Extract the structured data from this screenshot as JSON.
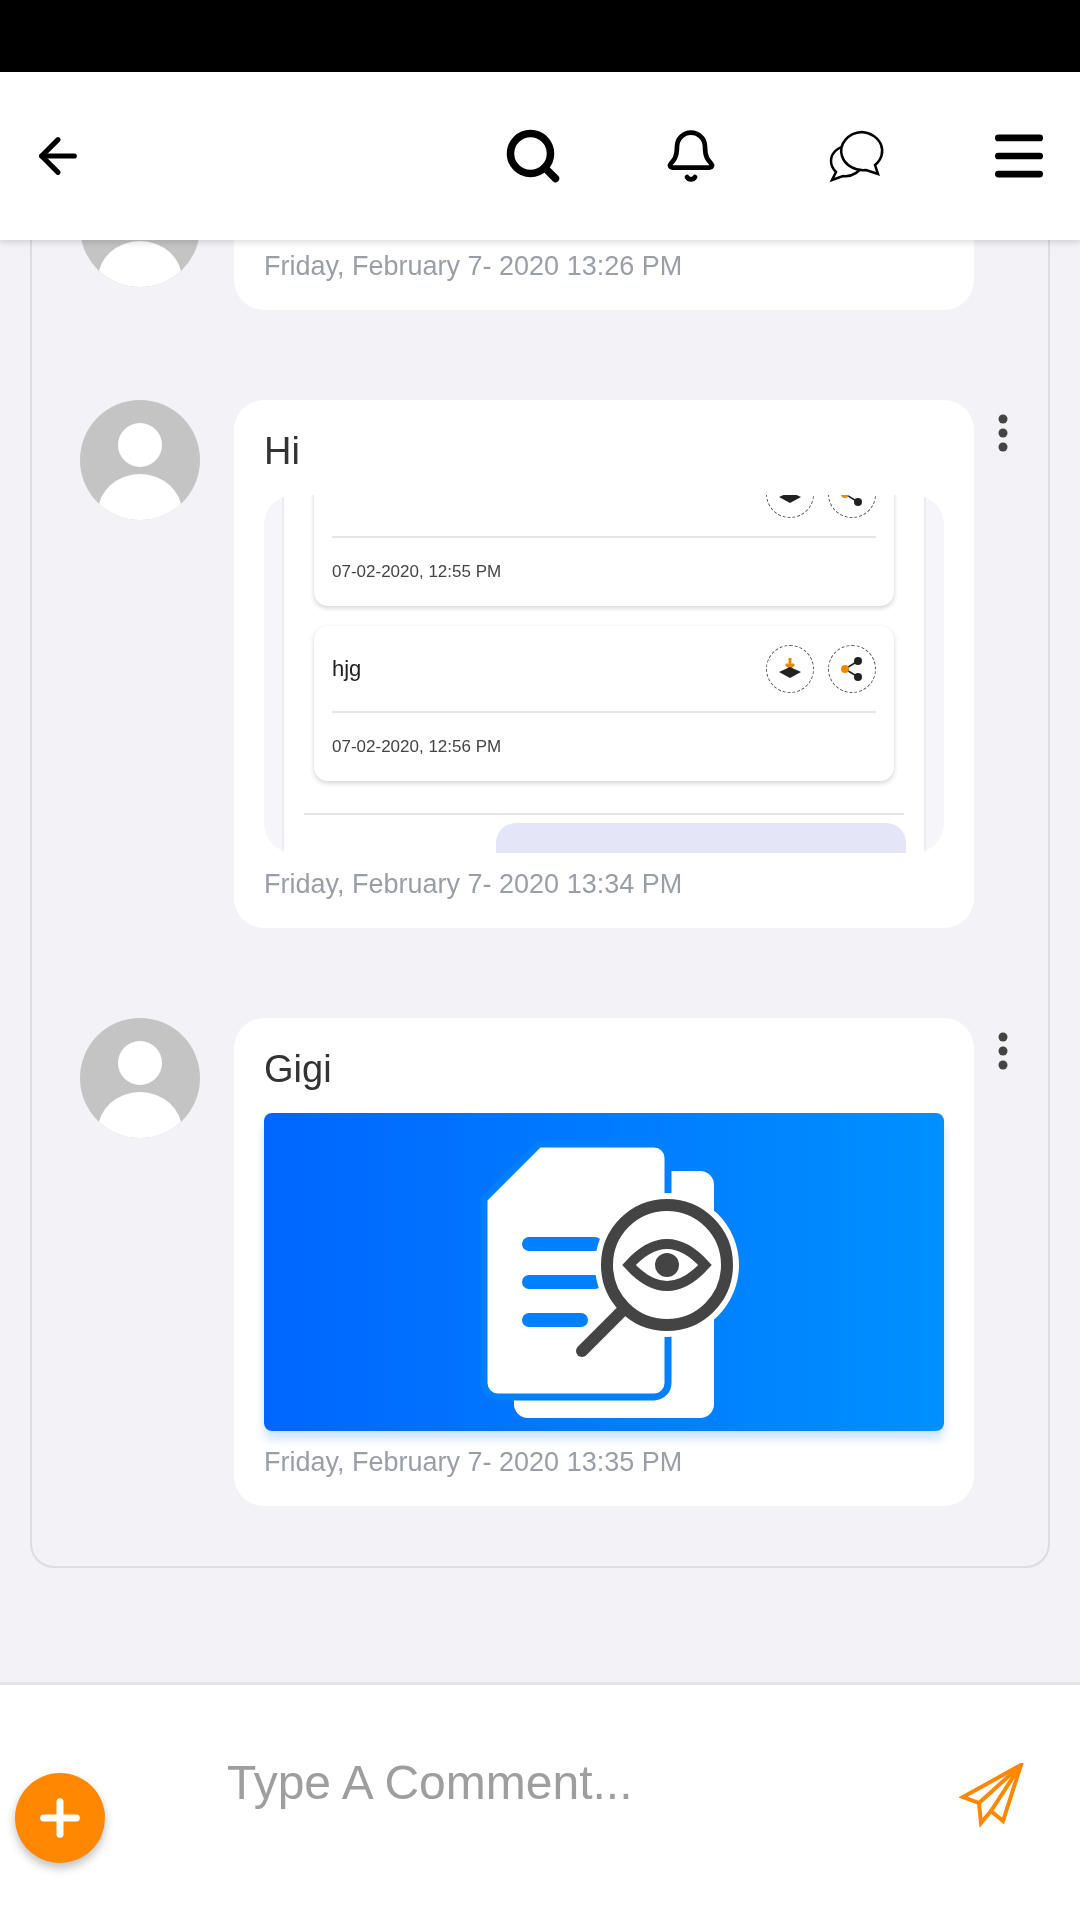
{
  "messages": [
    {
      "time": "Friday, February 7- 2020 13:26 PM"
    },
    {
      "text": "Hi",
      "attachment": {
        "kind": "screenshot",
        "cards": [
          {
            "time": "07-02-2020, 12:55 PM"
          },
          {
            "title": "hjg",
            "time": "07-02-2020, 12:56 PM"
          }
        ]
      },
      "time": "Friday, February 7- 2020 13:34 PM"
    },
    {
      "text": "Gigi",
      "time": "Friday, February 7- 2020 13:35 PM"
    }
  ],
  "composer": {
    "placeholder": "Type A Comment..."
  }
}
